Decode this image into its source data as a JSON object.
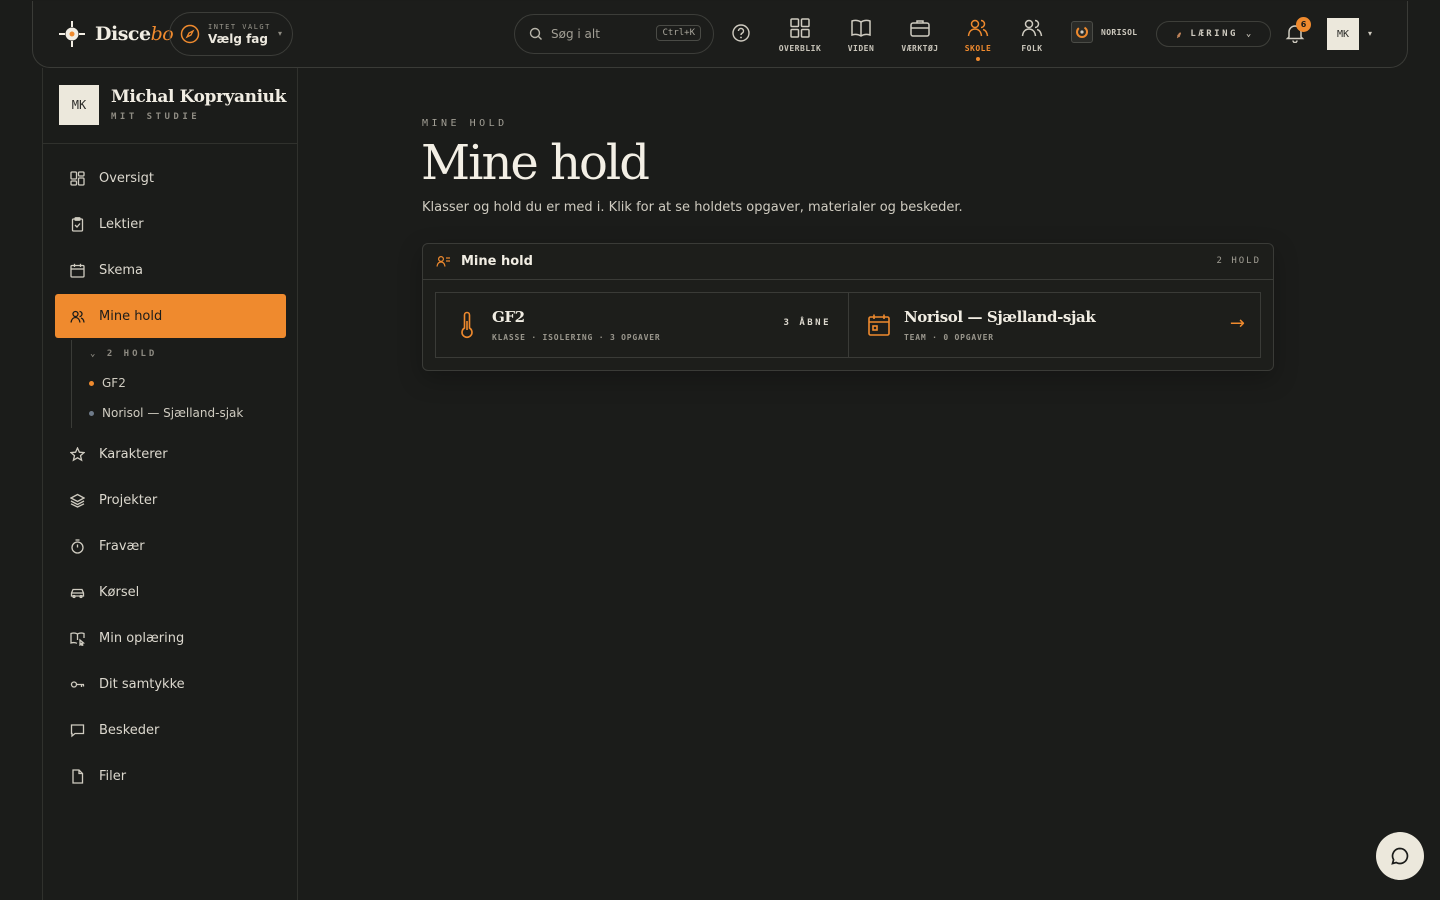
{
  "brand": {
    "name_a": "Disce",
    "name_b": "bo"
  },
  "subject_picker": {
    "caption": "INTET VALGT",
    "label": "Vælg fag"
  },
  "search": {
    "placeholder": "Søg i alt",
    "shortcut": "Ctrl+K"
  },
  "nav": [
    {
      "label": "OVERBLIK",
      "icon": "grid-icon"
    },
    {
      "label": "VIDEN",
      "icon": "book-icon"
    },
    {
      "label": "VÆRKTØJ",
      "icon": "briefcase-icon"
    },
    {
      "label": "SKOLE",
      "icon": "people-icon",
      "active": true
    },
    {
      "label": "FOLK",
      "icon": "people-icon"
    }
  ],
  "org": {
    "label": "NORISOL"
  },
  "mode": {
    "label": "LÆRING"
  },
  "notifications": {
    "count": "6"
  },
  "user": {
    "initials": "MK"
  },
  "profile": {
    "initials": "MK",
    "name": "Michal Kopryaniuk",
    "subtitle": "MIT STUDIE"
  },
  "sidebar": {
    "items": [
      {
        "label": "Oversigt",
        "icon": "dashboard-icon"
      },
      {
        "label": "Lektier",
        "icon": "clipboard-icon"
      },
      {
        "label": "Skema",
        "icon": "calendar-icon"
      },
      {
        "label": "Mine hold",
        "icon": "people-icon",
        "active": true
      },
      {
        "label": "Karakterer",
        "icon": "star-icon"
      },
      {
        "label": "Projekter",
        "icon": "layers-icon"
      },
      {
        "label": "Fravær",
        "icon": "stopwatch-icon"
      },
      {
        "label": "Kørsel",
        "icon": "car-icon"
      },
      {
        "label": "Min oplæring",
        "icon": "book-cursor-icon"
      },
      {
        "label": "Dit samtykke",
        "icon": "key-icon"
      },
      {
        "label": "Beskeder",
        "icon": "message-icon"
      },
      {
        "label": "Filer",
        "icon": "file-icon"
      }
    ],
    "subtree": {
      "header": "2 HOLD",
      "items": [
        "GF2",
        "Norisol — Sjælland-sjak"
      ]
    }
  },
  "main": {
    "eyebrow": "MINE HOLD",
    "title": "Mine hold",
    "description": "Klasser og hold du er med i. Klik for at se holdets opgaver, materialer og beskeder.",
    "card": {
      "title": "Mine hold",
      "count": "2 HOLD",
      "teams": [
        {
          "name": "GF2",
          "meta": "KLASSE · ISOLERING · 3 OPGAVER",
          "badge": "3 ÅBNE"
        },
        {
          "name": "Norisol — Sjælland-sjak",
          "meta": "TEAM · 0 OPGAVER",
          "badge": "→"
        }
      ]
    }
  },
  "colors": {
    "accent": "#ef8a2e",
    "background": "#1b1c1a",
    "text": "#e8e4da"
  }
}
